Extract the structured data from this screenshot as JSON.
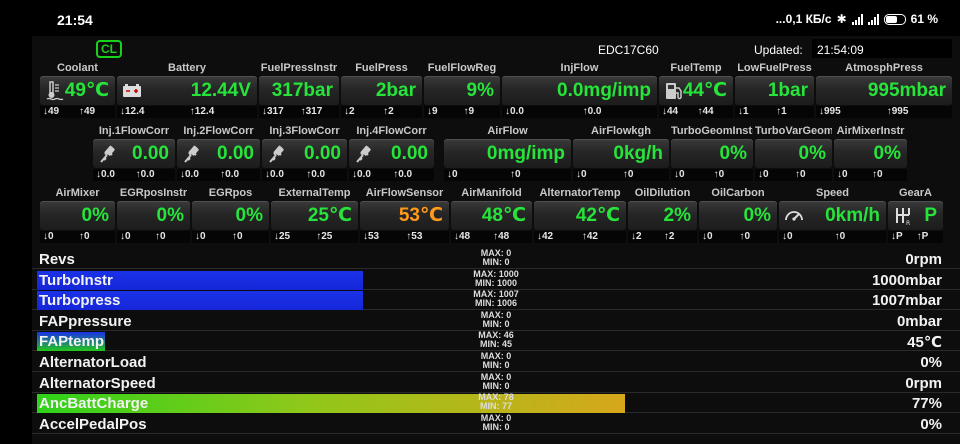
{
  "status_bar": {
    "time": "21:54",
    "net_speed": "...0,1 КБ/с",
    "battery_percent": "61 %",
    "icons": [
      "bluetooth-icon",
      "signal-icon",
      "signal-icon",
      "battery-icon"
    ]
  },
  "header": {
    "cl_badge": "CL",
    "ecu": "EDC17C60",
    "updated_label": "Updated:",
    "updated_time": "21:54:09"
  },
  "colors": {
    "value_green": "#26e43a",
    "value_orange": "#ff9a1a",
    "turbo_blue": "#1626d8",
    "fap_green": "#22c81a"
  },
  "gauges_row1": [
    {
      "title": "Coolant",
      "value": "49℃",
      "min": "↓49",
      "max": "↑49",
      "icon": "thermometer-icon"
    },
    {
      "title": "Battery",
      "value": "12.44V",
      "min": "↓12.4",
      "max": "↑12.4",
      "icon": "battery-icon"
    },
    {
      "title": "FuelPressInstr",
      "value": "317bar",
      "min": "↓317",
      "max": "↑317"
    },
    {
      "title": "FuelPress",
      "value": "2bar",
      "min": "↓2",
      "max": "↑2"
    },
    {
      "title": "FuelFlowReg",
      "value": "9%",
      "min": "↓9",
      "max": "↑9"
    },
    {
      "title": "InjFlow",
      "value": "0.0mg/imp",
      "min": "↓0.0",
      "max": "↑0.0"
    },
    {
      "title": "FuelTemp",
      "value": "44℃",
      "min": "↓44",
      "max": "↑44",
      "icon": "fuel-pump-icon"
    },
    {
      "title": "LowFuelPress",
      "value": "1bar",
      "min": "↓1",
      "max": "↑1"
    },
    {
      "title": "AtmosphPress",
      "value": "995mbar",
      "min": "↓995",
      "max": "↑995"
    }
  ],
  "gauges_row2": [
    {
      "title": "Inj.1FlowCorr",
      "value": "0.00",
      "min": "↓0.0",
      "max": "↑0.0",
      "icon": "injector-icon"
    },
    {
      "title": "Inj.2FlowCorr",
      "value": "0.00",
      "min": "↓0.0",
      "max": "↑0.0",
      "icon": "injector-icon"
    },
    {
      "title": "Inj.3FlowCorr",
      "value": "0.00",
      "min": "↓0.0",
      "max": "↑0.0",
      "icon": "injector-icon"
    },
    {
      "title": "Inj.4FlowCorr",
      "value": "0.00",
      "min": "↓0.0",
      "max": "↑0.0",
      "icon": "injector-icon"
    },
    {
      "title": "AirFlow",
      "value": "0mg/imp",
      "min": "↓0",
      "max": "↑0"
    },
    {
      "title": "AirFlowkgh",
      "value": "0kg/h",
      "min": "↓0",
      "max": "↑0"
    },
    {
      "title": "TurboGeomInstr",
      "value": "0%",
      "min": "↓0",
      "max": "↑0"
    },
    {
      "title": "TurboVarGeom",
      "value": "0%",
      "min": "↓0",
      "max": "↑0"
    },
    {
      "title": "AirMixerInstr",
      "value": "0%",
      "min": "↓0",
      "max": "↑0"
    }
  ],
  "gauges_row3": [
    {
      "title": "AirMixer",
      "value": "0%",
      "min": "↓0",
      "max": "↑0"
    },
    {
      "title": "EGRposInstr",
      "value": "0%",
      "min": "↓0",
      "max": "↑0"
    },
    {
      "title": "EGRpos",
      "value": "0%",
      "min": "↓0",
      "max": "↑0"
    },
    {
      "title": "ExternalTemp",
      "value": "25℃",
      "min": "↓25",
      "max": "↑25"
    },
    {
      "title": "AirFlowSensor",
      "value": "53℃",
      "min": "↓53",
      "max": "↑53",
      "highlight": "orange"
    },
    {
      "title": "AirManifold",
      "value": "48℃",
      "min": "↓48",
      "max": "↑48"
    },
    {
      "title": "AlternatorTemp",
      "value": "42℃",
      "min": "↓42",
      "max": "↑42"
    },
    {
      "title": "OilDilution",
      "value": "2%",
      "min": "↓2",
      "max": "↑2"
    },
    {
      "title": "OilCarbon",
      "value": "0%",
      "min": "↓0",
      "max": "↑0"
    },
    {
      "title": "Speed",
      "value": "0km/h",
      "min": "↓0",
      "max": "↑0",
      "icon": "speedometer-icon"
    },
    {
      "title": "GearA",
      "value": "P",
      "min": "↓P",
      "max": "↑P",
      "icon": "gear-shift-icon"
    }
  ],
  "bar_rows": [
    {
      "label": "Revs",
      "value": "0rpm",
      "max": "MAX: 0",
      "min": "MIN: 0",
      "fill_fraction": 0
    },
    {
      "label": "TurboInstr",
      "value": "1000mbar",
      "max": "MAX: 1000",
      "min": "MIN: 1000",
      "fill_fraction": 0.36,
      "color": "#1626d8"
    },
    {
      "label": "Turbopress",
      "value": "1007mbar",
      "max": "MAX: 1007",
      "min": "MIN: 1006",
      "fill_fraction": 0.36,
      "color": "#1626d8"
    },
    {
      "label": "FAPpressure",
      "value": "0mbar",
      "max": "MAX: 0",
      "min": "MIN: 0",
      "fill_fraction": 0
    },
    {
      "label": "FAPtemp",
      "value": "45℃",
      "max": "MAX: 46",
      "min": "MIN: 45",
      "fill_fraction": 0.075,
      "color": "#22c81a"
    },
    {
      "label": "AlternatorLoad",
      "value": "0%",
      "max": "MAX: 0",
      "min": "MIN: 0",
      "fill_fraction": 0
    },
    {
      "label": "AlternatorSpeed",
      "value": "0rpm",
      "max": "MAX: 0",
      "min": "MIN: 0",
      "fill_fraction": 0
    },
    {
      "label": "AncBattCharge",
      "value": "77%",
      "max": "MAX: 78",
      "min": "MIN: 77",
      "fill_fraction": 0.65,
      "color": "gradient"
    },
    {
      "label": "AccelPedalPos",
      "value": "0%",
      "max": "MAX: 0",
      "min": "MIN: 0",
      "fill_fraction": 0
    }
  ]
}
